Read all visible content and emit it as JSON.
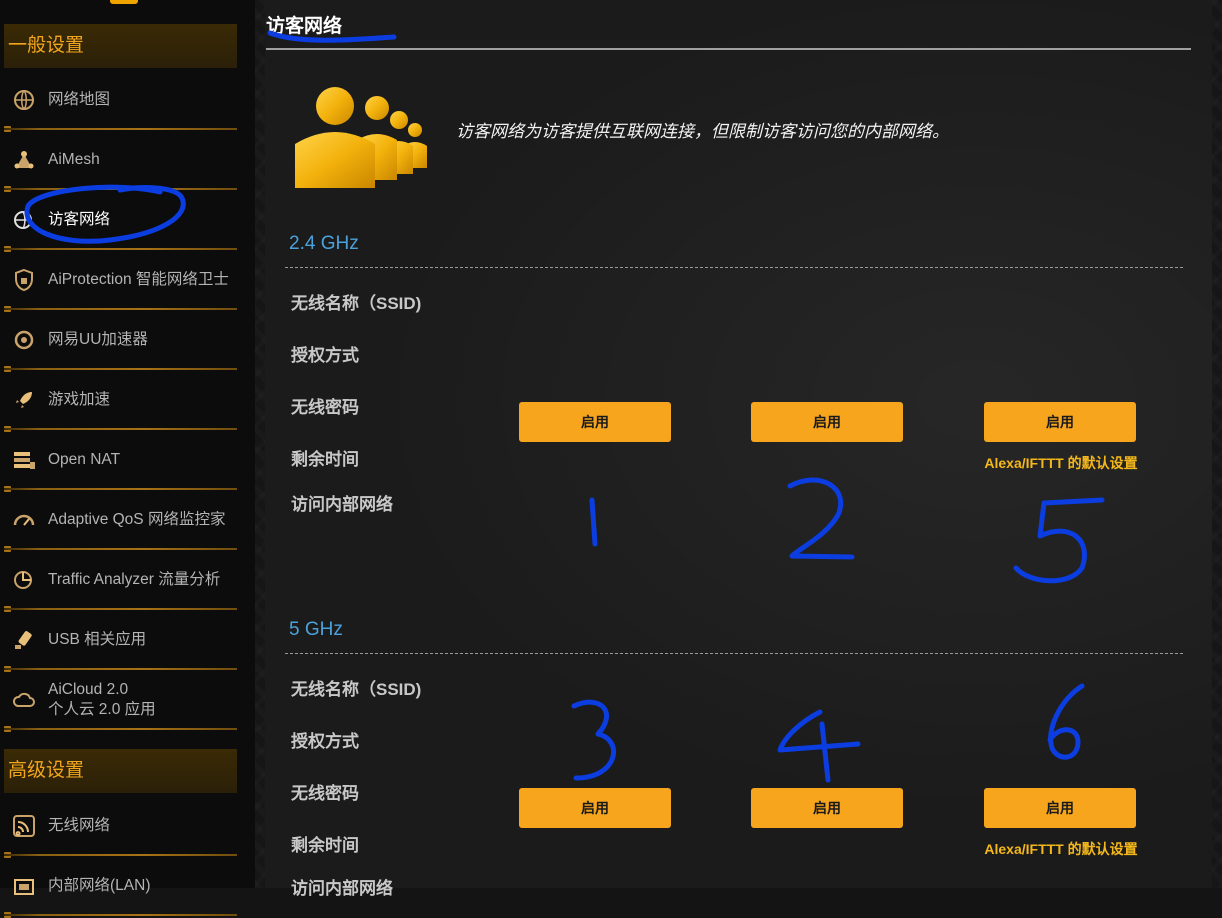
{
  "sidebar": {
    "general_header": "一般设置",
    "advanced_header": "高级设置",
    "items": [
      {
        "label": "网络地图",
        "icon": "network-map-icon",
        "active": false
      },
      {
        "label": "AiMesh",
        "icon": "aimesh-icon",
        "active": false
      },
      {
        "label": "访客网络",
        "icon": "guest-network-icon",
        "active": true
      },
      {
        "label": "AiProtection 智能网络卫士",
        "icon": "shield-icon",
        "active": false
      },
      {
        "label": "网易UU加速器",
        "icon": "uu-accelerator-icon",
        "active": false
      },
      {
        "label": "游戏加速",
        "icon": "rocket-icon",
        "active": false
      },
      {
        "label": "Open NAT",
        "icon": "open-nat-icon",
        "active": false
      },
      {
        "label": "Adaptive QoS 网络监控家",
        "icon": "gauge-icon",
        "active": false
      },
      {
        "label": "Traffic Analyzer 流量分析",
        "icon": "traffic-analyzer-icon",
        "active": false
      },
      {
        "label": "USB 相关应用",
        "icon": "usb-icon",
        "active": false
      },
      {
        "label_line1": "AiCloud 2.0",
        "label_line2": "个人云 2.0 应用",
        "icon": "cloud-icon",
        "active": false
      }
    ],
    "advanced_items": [
      {
        "label": "无线网络",
        "icon": "wireless-icon"
      },
      {
        "label": "内部网络(LAN)",
        "icon": "lan-icon"
      }
    ]
  },
  "page": {
    "title": "访客网络",
    "description": "访客网络为访客提供互联网连接，但限制访客访问您的内部网络。"
  },
  "bands": [
    {
      "title": "2.4 GHz",
      "rows": [
        "无线名称（SSID)",
        "授权方式",
        "无线密码",
        "剩余时间",
        "访问内部网络"
      ],
      "enable_labels": [
        "启用",
        "启用",
        "启用"
      ],
      "note": "Alexa/IFTTT 的默认设置"
    },
    {
      "title": "5 GHz",
      "rows": [
        "无线名称（SSID)",
        "授权方式",
        "无线密码",
        "剩余时间",
        "访问内部网络"
      ],
      "enable_labels": [
        "启用",
        "启用",
        "启用"
      ],
      "note": "Alexa/IFTTT 的默认设置"
    }
  ],
  "annotations": [
    "1",
    "2",
    "5",
    "3",
    "4",
    "6"
  ],
  "colors": {
    "accent": "#f7a51d",
    "band_title": "#4aa2dc",
    "annotation_ink": "#0b3de0",
    "note": "#f5b81c"
  }
}
